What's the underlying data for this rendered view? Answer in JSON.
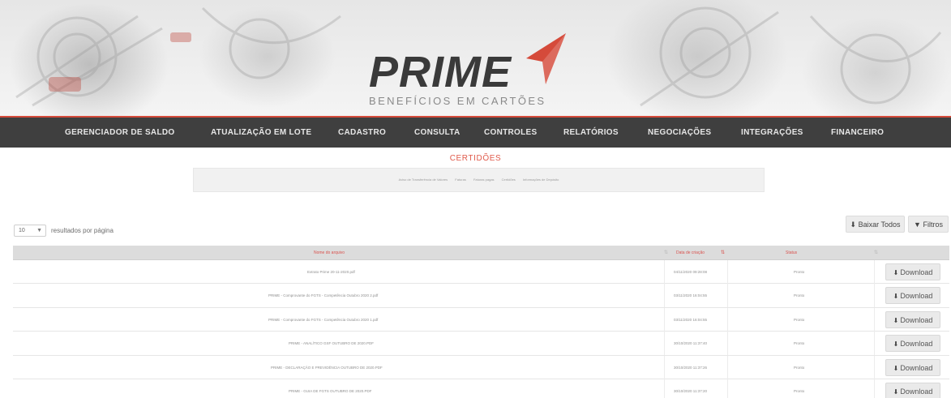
{
  "brand": {
    "logo": "PRIME",
    "tagline": "BENEFÍCIOS EM CARTÕES",
    "accent_color": "#d54a3a"
  },
  "nav": {
    "items": [
      {
        "label": "GERENCIADOR DE SALDO"
      },
      {
        "label": "ATUALIZAÇÃO EM LOTE"
      },
      {
        "label": "CADASTRO"
      },
      {
        "label": "CONSULTA"
      },
      {
        "label": "CONTROLES"
      },
      {
        "label": "RELATÓRIOS"
      },
      {
        "label": "NEGOCIAÇÕES"
      },
      {
        "label": "INTEGRAÇÕES"
      },
      {
        "label": "FINANCEIRO"
      }
    ]
  },
  "page": {
    "title": "CERTIDÕES"
  },
  "subnav": {
    "items": [
      {
        "label": "Aviso de Transferência de Valores"
      },
      {
        "label": "Faturas"
      },
      {
        "label": "Faturas pagas"
      },
      {
        "label": "Certidões"
      },
      {
        "label": "Informações de Depósito"
      }
    ]
  },
  "controls": {
    "page_length": "10",
    "page_length_label": "resultados por página",
    "download_all": "Baixar Todos",
    "filters": "Filtros"
  },
  "table": {
    "headers": {
      "file_name": "Nome do arquivo",
      "created": "Data de criação",
      "status": "Status"
    },
    "rows": [
      {
        "file": "Extrato Prime 20-11-2020.pdf",
        "date": "04/11/2020 09:28:08",
        "status": "Pronto",
        "action": "Download"
      },
      {
        "file": "PRIME - Comprovante do FGTS - Competência Outubro 2020 2.pdf",
        "date": "03/11/2020 16:04:55",
        "status": "Pronto",
        "action": "Download"
      },
      {
        "file": "PRIME - Comprovante do FGTS - Competência Outubro 2020 1.pdf",
        "date": "03/11/2020 16:04:55",
        "status": "Pronto",
        "action": "Download"
      },
      {
        "file": "PRIME - ANALÍTICO GSF OUTUBRO DE 2020.PDF",
        "date": "30/10/2020 11:37:40",
        "status": "Pronto",
        "action": "Download"
      },
      {
        "file": "PRIME - DECLARAÇÃO E PREVIDÊNCIA OUTUBRO DE 2020.PDF",
        "date": "30/10/2020 11:37:26",
        "status": "Pronto",
        "action": "Download"
      },
      {
        "file": "PRIME - GUIA DE FGTS OUTUBRO DE 2020.PDF",
        "date": "30/10/2020 11:37:20",
        "status": "Pronto",
        "action": "Download"
      }
    ]
  }
}
